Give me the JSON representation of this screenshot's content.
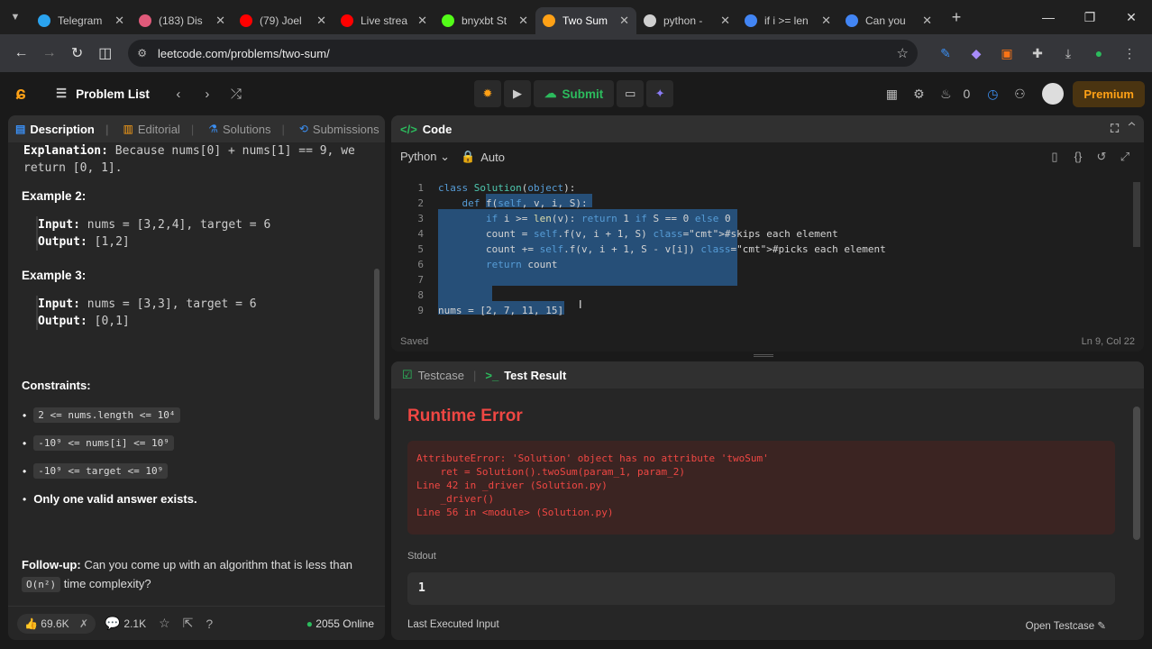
{
  "browser": {
    "tabs": [
      {
        "title": "Telegram",
        "icon": "telegram-icon",
        "color": "#2aa3ef"
      },
      {
        "title": "(183) Dis",
        "icon": "discord-icon",
        "color": "#e05a7a"
      },
      {
        "title": "(79) Joel",
        "icon": "youtube-icon",
        "color": "#ff0000"
      },
      {
        "title": "Live strea",
        "icon": "youtube-icon",
        "color": "#ff0000"
      },
      {
        "title": "bnyxbt St",
        "icon": "kick-icon",
        "color": "#53fc18"
      },
      {
        "title": "Two Sum",
        "icon": "leetcode-icon",
        "color": "#ffa116",
        "active": true
      },
      {
        "title": "python -",
        "icon": "stackoverflow-icon",
        "color": "#cfcfcf"
      },
      {
        "title": "if i >= len",
        "icon": "google-icon",
        "color": "#4285f4"
      },
      {
        "title": "Can you",
        "icon": "google-icon",
        "color": "#4285f4"
      }
    ],
    "url": "leetcode.com/problems/two-sum/"
  },
  "lcnav": {
    "problem_list": "Problem List",
    "submit": "Submit",
    "streak": "0",
    "premium": "Premium"
  },
  "left": {
    "tabs": {
      "description": "Description",
      "editorial": "Editorial",
      "solutions": "Solutions",
      "submissions": "Submissions"
    },
    "explanation_label": "Explanation:",
    "explanation_text": " Because nums[0] + nums[1] == 9, we return [0, 1].",
    "example2": {
      "title": "Example 2:",
      "input_label": "Input:",
      "input": " nums = [3,2,4], target = 6",
      "output_label": "Output:",
      "output": " [1,2]"
    },
    "example3": {
      "title": "Example 3:",
      "input_label": "Input:",
      "input": " nums = [3,3], target = 6",
      "output_label": "Output:",
      "output": " [0,1]"
    },
    "constraints_title": "Constraints:",
    "constraints": [
      "2 <= nums.length <= 10⁴",
      "-10⁹ <= nums[i] <= 10⁹",
      "-10⁹ <= target <= 10⁹"
    ],
    "constraint_last": "Only one valid answer exists.",
    "followup_label": "Follow-up:",
    "followup_text": " Can you come up with an algorithm that is less than",
    "followup_code": "O(n²)",
    "followup_tail": " time complexity?",
    "likes": "69.6K",
    "comments": "2.1K",
    "online": "2055 Online"
  },
  "code": {
    "title": "Code",
    "language": "Python",
    "mode": "Auto",
    "lines": [
      "class Solution(object):",
      "    def f(self, v, i, S):",
      "        if i >= len(v): return 1 if S == 0 else 0",
      "        count = self.f(v, i + 1, S) #skips each element",
      "        count += self.f(v, i + 1, S - v[i]) #picks each element",
      "        return count",
      "",
      "        ",
      "nums = [2, 7, 11, 15]"
    ],
    "saved": "Saved",
    "position": "Ln 9, Col 22"
  },
  "result": {
    "tab_testcase": "Testcase",
    "tab_result": "Test Result",
    "error_title": "Runtime Error",
    "error_text": "AttributeError: 'Solution' object has no attribute 'twoSum'\n    ret = Solution().twoSum(param_1, param_2)\nLine 42 in _driver (Solution.py)\n    _driver()\nLine 56 in <module> (Solution.py)",
    "stdout_label": "Stdout",
    "stdout": "1",
    "last_input_label": "Last Executed Input",
    "open_testcase": "Open Testcase"
  }
}
